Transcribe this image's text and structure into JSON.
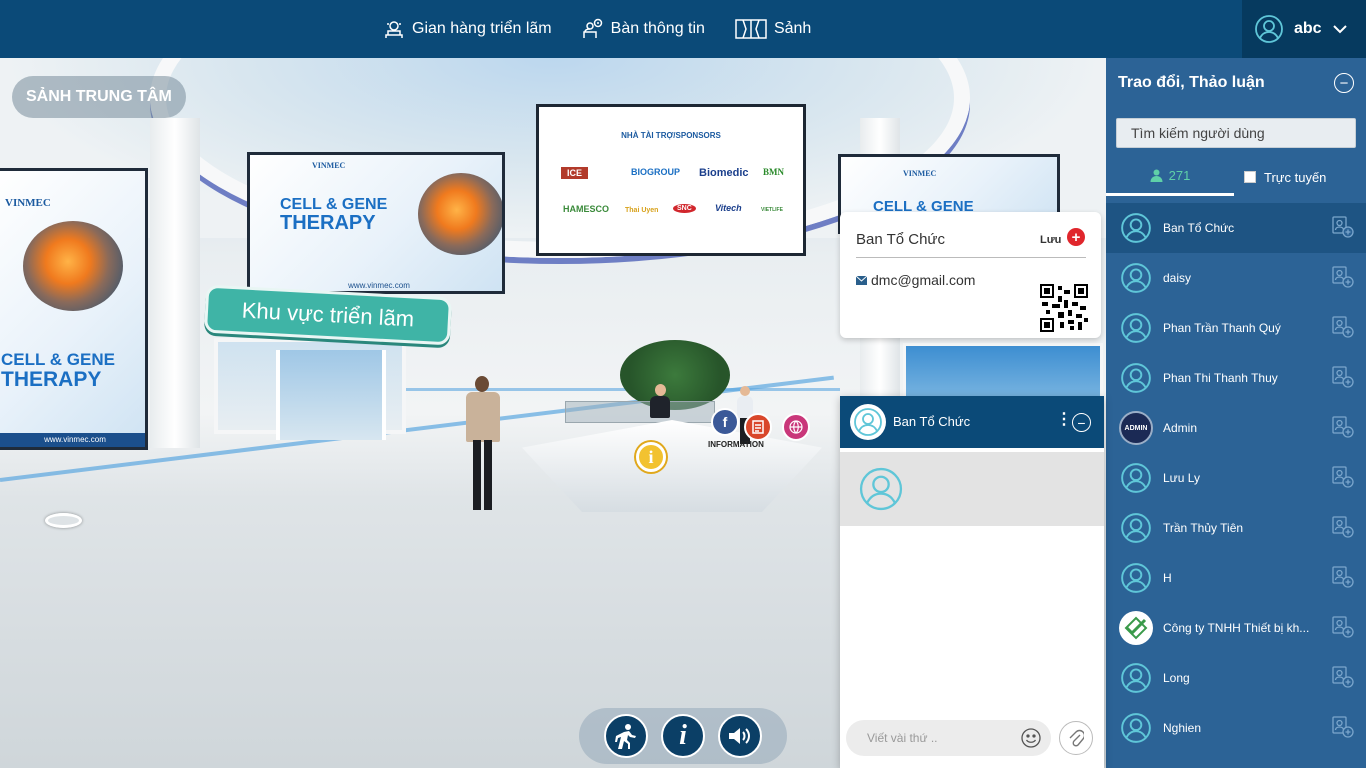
{
  "topbar": {
    "nav": [
      {
        "label": "Gian hàng triển lãm",
        "icon": "booth-icon"
      },
      {
        "label": "Bàn thông tin",
        "icon": "info-desk-icon"
      },
      {
        "label": "Sảnh",
        "icon": "lobby-icon"
      }
    ],
    "user": {
      "name": "abc",
      "icon": "user-circle-icon"
    }
  },
  "scene": {
    "location_label": "SẢNH TRUNG TÂM",
    "exhibition_sign": "Khu vực triển lãm",
    "info_label": "INFORMATION",
    "banner_left": {
      "logo": "VINMEC",
      "title_line1": "CELL & GENE",
      "title_line2": "THERAPY",
      "url": "www.vinmec.com"
    },
    "banner_center_left": {
      "logo": "VINMEC",
      "title_line1": "CELL & GENE",
      "title_line2": "THERAPY",
      "url": "www.vinmec.com"
    },
    "banner_right": {
      "logo": "VINMEC",
      "title_line1": "CELL & GENE"
    },
    "sponsor_board": {
      "title": "NHÀ TÀI TRỢ/SPONSORS",
      "logos": [
        "ICE",
        "BIOGROUP",
        "Biomedic",
        "BMN",
        "HAMESCO",
        "Thai Uyen",
        "SNC",
        "Vitech",
        "VIETLIFE"
      ]
    },
    "controls": [
      {
        "name": "walk-button",
        "icon": "walk-icon"
      },
      {
        "name": "info-button",
        "icon": "info-icon"
      },
      {
        "name": "sound-button",
        "icon": "volume-icon"
      }
    ]
  },
  "contact_card": {
    "name": "Ban Tổ Chức",
    "save_label": "Lưu",
    "email": "dmc@gmail.com"
  },
  "chat_window": {
    "title": "Ban Tổ Chức",
    "input_placeholder": "Viết vài thứ .."
  },
  "sidebar": {
    "title": "Trao đổi, Thảo luận",
    "search_placeholder": "Tìm kiếm người dùng",
    "user_count": "271",
    "online_filter_label": "Trực tuyến",
    "users": [
      {
        "name": "Ban Tổ Chức",
        "avatar": "default"
      },
      {
        "name": "daisy",
        "avatar": "default"
      },
      {
        "name": "Phan Trần Thanh Quý",
        "avatar": "default"
      },
      {
        "name": "Phan Thi Thanh Thuy",
        "avatar": "default"
      },
      {
        "name": "Admin",
        "avatar": "admin",
        "avatar_text": "ADMIN"
      },
      {
        "name": "Lưu Ly",
        "avatar": "default"
      },
      {
        "name": "Trần Thủy Tiên",
        "avatar": "default"
      },
      {
        "name": "H",
        "avatar": "default"
      },
      {
        "name": "Công ty TNHH Thiết bị kh...",
        "avatar": "company"
      },
      {
        "name": "Long",
        "avatar": "default"
      },
      {
        "name": "Nghien",
        "avatar": "default"
      }
    ]
  },
  "colors": {
    "topbar": "#0b4a78",
    "sidebar": "#2c6396",
    "accent_teal": "#3fb4a6",
    "online_green": "#5fd0a8",
    "danger": "#e0262c"
  }
}
